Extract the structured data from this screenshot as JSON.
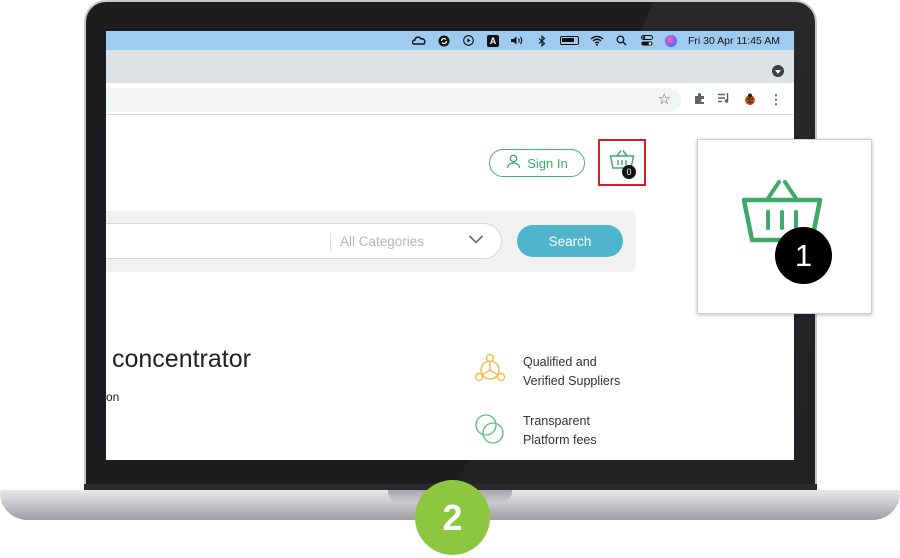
{
  "menubar": {
    "clock": "Fri 30 Apr  11:45 AM",
    "icons": [
      "creative-cloud-icon",
      "sync-icon",
      "play-icon",
      "input-source-icon",
      "volume-icon",
      "bluetooth-icon",
      "battery-icon",
      "wifi-icon",
      "spotlight-icon",
      "control-center-icon",
      "siri-icon"
    ],
    "input_source_label": "A"
  },
  "browser": {
    "toolbar_icons": [
      "star-icon",
      "extensions-icon",
      "reading-list-icon",
      "ladybug-icon",
      "more-menu-icon"
    ]
  },
  "header": {
    "signin_label": "Sign In",
    "cart_count": "0",
    "accent_color": "#3fa96a",
    "highlight_color": "#d32027"
  },
  "search": {
    "category_placeholder": "All Categories",
    "button_label": "Search",
    "button_color": "#4fb3cb"
  },
  "hero": {
    "headline": "concentrator",
    "subline": "on"
  },
  "features": [
    {
      "line1": "Qualified and",
      "line2": "Verified Suppliers",
      "icon": "supplier-network-icon"
    },
    {
      "line1": "Transparent",
      "line2": "Platform fees",
      "icon": "overlap-circles-icon"
    }
  ],
  "callout": {
    "badge": "1"
  },
  "step": {
    "badge": "2",
    "color": "#8dc63f"
  }
}
